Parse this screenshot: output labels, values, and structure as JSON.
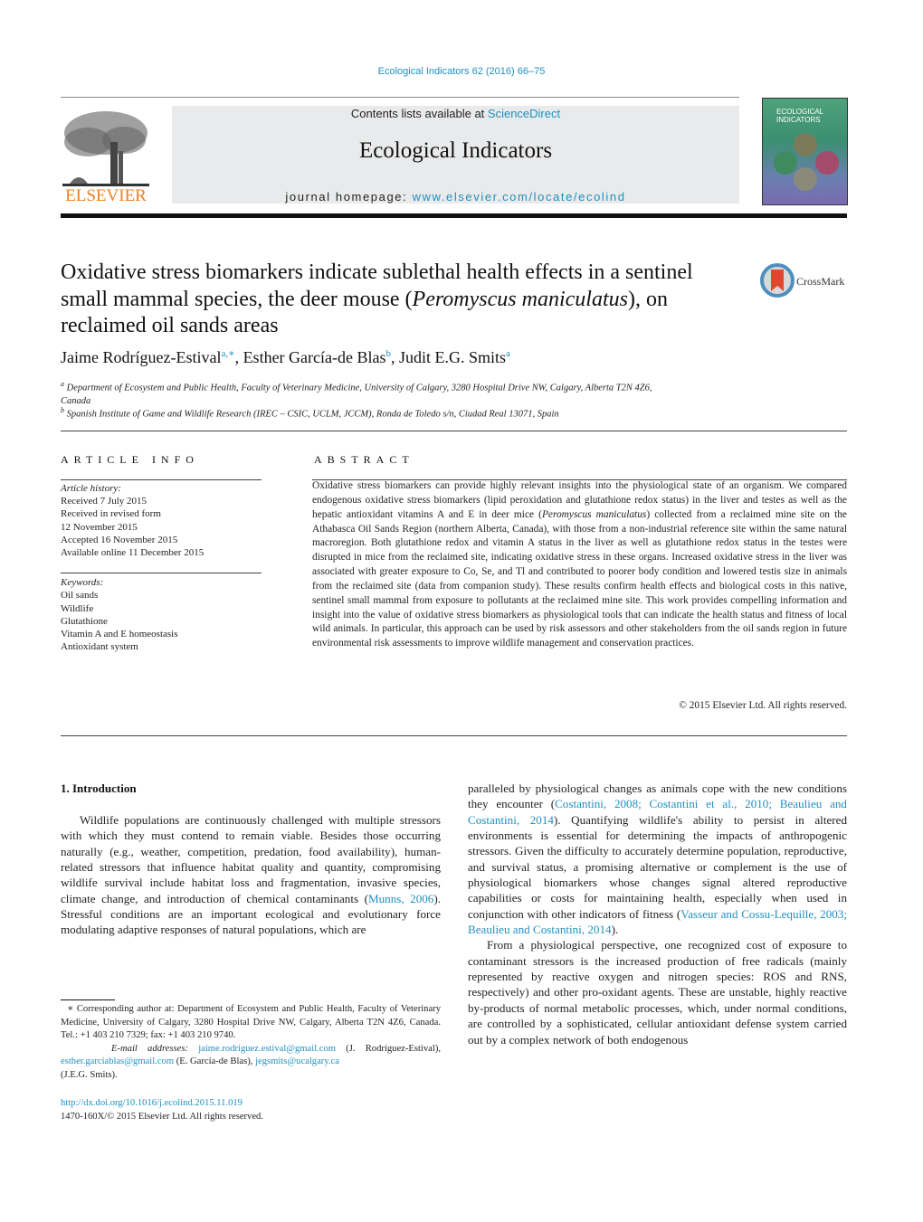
{
  "header": {
    "journal_ref": "Ecological Indicators 62 (2016) 66–75",
    "contents_prefix": "Contents lists available at ",
    "contents_link": "ScienceDirect",
    "journal_name": "Ecological Indicators",
    "homepage_prefix": "journal homepage: ",
    "homepage_link": "www.elsevier.com/locate/ecolind",
    "publisher_logo_text": "ELSEVIER",
    "cover_title_1": "ECOLOGICAL",
    "cover_title_2": "INDICATORS",
    "crossmark_label": "CrossMark",
    "colors": {
      "link": "#1f8fc1",
      "publisher": "#f07f1b"
    }
  },
  "article": {
    "title_part1": "Oxidative stress biomarkers indicate sublethal health effects in a sentinel small mammal species, the deer mouse (",
    "title_italic": "Peromyscus maniculatus",
    "title_part2": "), on reclaimed oil sands areas",
    "authors": [
      {
        "name": "Jaime Rodríguez-Estival",
        "sup": "a,∗",
        "sep": ", "
      },
      {
        "name": "Esther García-de Blas",
        "sup": "b",
        "sep": ", "
      },
      {
        "name": "Judit E.G. Smits",
        "sup": "a",
        "sep": ""
      }
    ],
    "affiliations": [
      {
        "sup": "a",
        "text": "Department of Ecosystem and Public Health, Faculty of Veterinary Medicine, University of Calgary, 3280 Hospital Drive NW, Calgary, Alberta T2N 4Z6, Canada"
      },
      {
        "sup": "b",
        "text": "Spanish Institute of Game and Wildlife Research (IREC – CSIC, UCLM, JCCM), Ronda de Toledo s/n, Ciudad Real 13071, Spain"
      }
    ]
  },
  "article_info": {
    "heading": "ARTICLE INFO",
    "history_label": "Article history:",
    "history": [
      "Received 7 July 2015",
      "Received in revised form",
      "12 November 2015",
      "Accepted 16 November 2015",
      "Available online 11 December 2015"
    ],
    "keywords_label": "Keywords:",
    "keywords": [
      "Oil sands",
      "Wildlife",
      "Glutathione",
      "Vitamin A and E homeostasis",
      "Antioxidant system"
    ]
  },
  "abstract": {
    "heading": "ABSTRACT",
    "text_part1": "Oxidative stress biomarkers can provide highly relevant insights into the physiological state of an organism. We compared endogenous oxidative stress biomarkers (lipid peroxidation and glutathione redox status) in the liver and testes as well as the hepatic antioxidant vitamins A and E in deer mice (",
    "text_italic": "Peromyscus maniculatus",
    "text_part2": ") collected from a reclaimed mine site on the Athabasca Oil Sands Region (northern Alberta, Canada), with those from a non-industrial reference site within the same natural macroregion. Both glutathione redox and vitamin A status in the liver as well as glutathione redox status in the testes were disrupted in mice from the reclaimed site, indicating oxidative stress in these organs. Increased oxidative stress in the liver was associated with greater exposure to Co, Se, and Tl and contributed to poorer body condition and lowered testis size in animals from the reclaimed site (data from companion study). These results confirm health effects and biological costs in this native, sentinel small mammal from exposure to pollutants at the reclaimed mine site. This work provides compelling information and insight into the value of oxidative stress biomarkers as physiological tools that can indicate the health status and fitness of local wild animals. In particular, this approach can be used by risk assessors and other stakeholders from the oil sands region in future environmental risk assessments to improve wildlife management and conservation practices.",
    "copyright": "© 2015 Elsevier Ltd. All rights reserved."
  },
  "body": {
    "intro_heading": "1.  Introduction",
    "left_para_part1": "Wildlife populations are continuously challenged with multiple stressors with which they must contend to remain viable. Besides those occurring naturally (e.g., weather, competition, predation, food availability), human-related stressors that influence habitat quality and quantity, compromising wildlife survival include habitat loss and fragmentation, invasive species, climate change, and introduction of chemical contaminants (",
    "left_cite": "Munns, 2006",
    "left_para_part2": "). Stressful conditions are an important ecological and evolutionary force modulating adaptive responses of natural populations, which are",
    "right_para1_part1": "paralleled by physiological changes as animals cope with the new conditions they encounter (",
    "right_cite1": "Costantini, 2008; Costantini et al., 2010; Beaulieu and Costantini, 2014",
    "right_para1_part2": "). Quantifying wildlife's ability to persist in altered environments is essential for determining the impacts of anthropogenic stressors. Given the difficulty to accurately determine population, reproductive, and survival status, a promising alternative or complement is the use of physiological biomarkers whose changes signal altered reproductive capabilities or costs for maintaining health, especially when used in conjunction with other indicators of fitness (",
    "right_cite2": "Vasseur and Cossu-Lequille, 2003; Beaulieu and Costantini, 2014",
    "right_para1_part3": ").",
    "right_para2": "From a physiological perspective, one recognized cost of exposure to contaminant stressors is the increased production of free radicals (mainly represented by reactive oxygen and nitrogen species: ROS and RNS, respectively) and other pro-oxidant agents. These are unstable, highly reactive by-products of normal metabolic processes, which, under normal conditions, are controlled by a sophisticated, cellular antioxidant defense system carried out by a complex network of both endogenous"
  },
  "footnote": {
    "star": "∗",
    "corresponding": " Corresponding author at: Department of Ecosystem and Public Health, Faculty of Veterinary Medicine, University of Calgary, 3280 Hospital Drive NW, Calgary, Alberta T2N 4Z6, Canada. Tel.: +1 403 210 7329; fax: +1 403 210 9740.",
    "email_label": "E-mail addresses:",
    "emails": [
      {
        "address": "jaime.rodriguez.estival@gmail.com",
        "who": " (J. Rodríguez-Estival), "
      },
      {
        "address": "esther.garciablas@gmail.com",
        "who": " (E. García-de Blas), "
      },
      {
        "address": "jegsmits@ucalgary.ca",
        "who": " (J.E.G. Smits)."
      }
    ],
    "doi": "http://dx.doi.org/10.1016/j.ecolind.2015.11.019",
    "issn": "1470-160X/© 2015 Elsevier Ltd. All rights reserved."
  }
}
